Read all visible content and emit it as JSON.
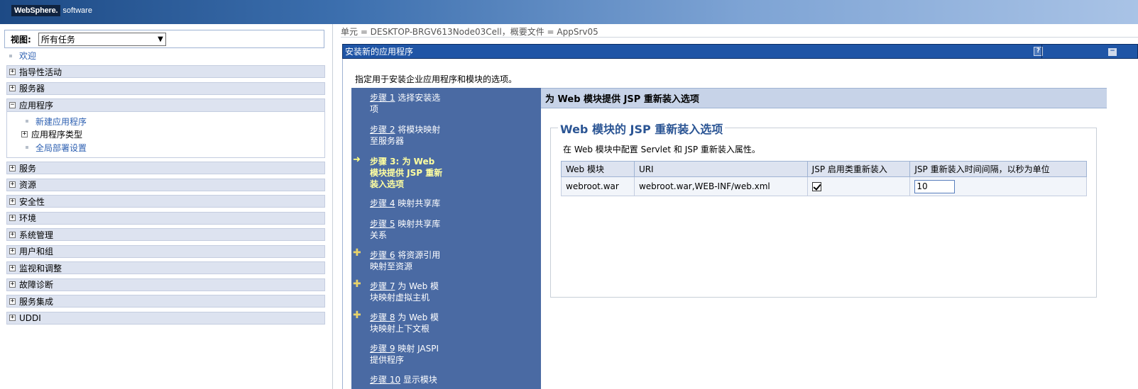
{
  "banner": {
    "logo_brand": "WebSphere.",
    "logo_software": "software"
  },
  "leftnav": {
    "view_label": "视图:",
    "view_selected": "所有任务",
    "welcome": "欢迎",
    "items": [
      {
        "label": "指导性活动",
        "state": "+"
      },
      {
        "label": "服务器",
        "state": "+"
      }
    ],
    "applications": {
      "label": "应用程序",
      "state": "−",
      "children": [
        {
          "label": "新建应用程序",
          "type": "link"
        },
        {
          "label": "应用程序类型",
          "type": "expand",
          "state": "+"
        },
        {
          "label": "全局部署设置",
          "type": "link"
        }
      ]
    },
    "items_after": [
      {
        "label": "服务",
        "state": "+"
      },
      {
        "label": "资源",
        "state": "+"
      },
      {
        "label": "安全性",
        "state": "+"
      },
      {
        "label": "环境",
        "state": "+"
      },
      {
        "label": "系统管理",
        "state": "+"
      },
      {
        "label": "用户和组",
        "state": "+"
      },
      {
        "label": "监视和调整",
        "state": "+"
      },
      {
        "label": "故障诊断",
        "state": "+"
      },
      {
        "label": "服务集成",
        "state": "+"
      },
      {
        "label": "UDDI",
        "state": "+"
      }
    ]
  },
  "context": "单元 = DESKTOP-BRGV613Node03Cell，概要文件 = AppSrv05",
  "panel": {
    "title": "安装新的应用程序",
    "help_icon": "?",
    "minimize_icon": "−",
    "description": "指定用于安装企业应用程序和模块的选项。"
  },
  "steps": [
    {
      "num": "步骤 1",
      "text_a": " 选择安装选",
      "text_b": "项"
    },
    {
      "num": "步骤 2",
      "text_a": " 将模块映射",
      "text_b": "至服务器"
    },
    {
      "num": "",
      "text_a": "步骤 3: 为 Web",
      "text_b": "模块提供 JSP 重新",
      "text_c": "装入选项",
      "current": true
    },
    {
      "num": "步骤 4",
      "text_a": " 映射共享库",
      "text_b": ""
    },
    {
      "num": "步骤 5",
      "text_a": " 映射共享库",
      "text_b": "关系"
    },
    {
      "num": "步骤 6",
      "text_a": " 将资源引用",
      "text_b": "映射至资源"
    },
    {
      "num": "步骤 7",
      "text_a": " 为 Web 模",
      "text_b": "块映射虚拟主机"
    },
    {
      "num": "步骤 8",
      "text_a": " 为 Web 模",
      "text_b": "块映射上下文根"
    },
    {
      "num": "步骤 9",
      "text_a": " 映射 JASPI",
      "text_b": "提供程序"
    },
    {
      "num": "步骤 10",
      "text_a": " 显示模块",
      "text_b": ""
    }
  ],
  "main": {
    "header": "为 Web 模块提供 JSP 重新装入选项",
    "legend": "Web 模块的 JSP 重新装入选项",
    "description": "在 Web 模块中配置 Servlet 和 JSP 重新装入属性。",
    "columns": [
      "Web 模块",
      "URI",
      "JSP 启用类重新装入",
      "JSP 重新装入时间间隔，以秒为单位"
    ],
    "rows": [
      {
        "module": "webroot.war",
        "uri": "webroot.war,WEB-INF/web.xml",
        "reload_enabled": true,
        "interval": "10"
      }
    ]
  }
}
